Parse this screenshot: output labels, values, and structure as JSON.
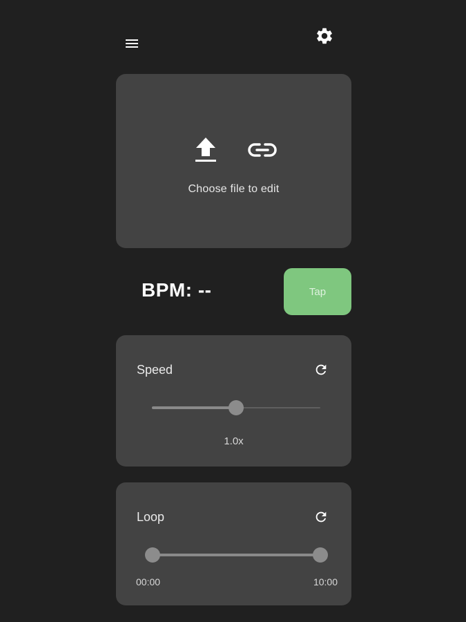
{
  "header": {
    "menu_icon": "hamburger-menu-icon",
    "settings_icon": "gear-icon"
  },
  "file_picker": {
    "upload_icon": "upload-icon",
    "link_icon": "link-icon",
    "label": "Choose file to edit"
  },
  "bpm": {
    "label": "BPM: --",
    "tap_label": "Tap",
    "tap_color": "#7fc77f"
  },
  "speed": {
    "title": "Speed",
    "reset_icon": "refresh-icon",
    "value_label": "1.0x",
    "slider_fraction": 0.5
  },
  "loop": {
    "title": "Loop",
    "reset_icon": "refresh-icon",
    "start_label": "00:00",
    "end_label": "10:00",
    "start_fraction": 0.0,
    "end_fraction": 1.0
  },
  "colors": {
    "background": "#202020",
    "card": "#434343",
    "accent": "#7fc77f"
  }
}
